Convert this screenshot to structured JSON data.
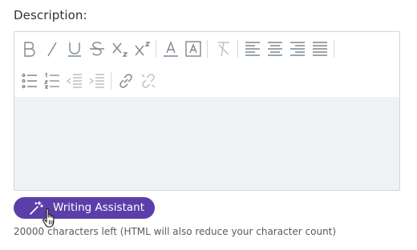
{
  "field": {
    "label": "Description:"
  },
  "toolbar": {
    "row1": [
      "bold-icon",
      "italic-icon",
      "underline-icon",
      "strikethrough-icon",
      "subscript-icon",
      "superscript-icon",
      "font-color-icon",
      "background-color-icon",
      "clear-formatting-icon",
      "align-left-icon",
      "align-center-icon",
      "align-right-icon",
      "align-justify-icon"
    ],
    "row2": [
      "bullet-list-icon",
      "numbered-list-icon",
      "outdent-icon",
      "indent-icon",
      "insert-link-icon",
      "remove-link-icon"
    ]
  },
  "editor": {
    "content": ""
  },
  "writing_assistant": {
    "label": "Writing Assistant",
    "color": "#5b3fa8",
    "icon": "magic-wand-icon"
  },
  "hint": {
    "text": "20000 characters left (HTML will also reduce your character count)"
  },
  "colors": {
    "icon": "#7c8791",
    "icon_disabled": "#b9c1c7",
    "border": "#cfd4d8",
    "editor_bg": "#eef2f3"
  }
}
